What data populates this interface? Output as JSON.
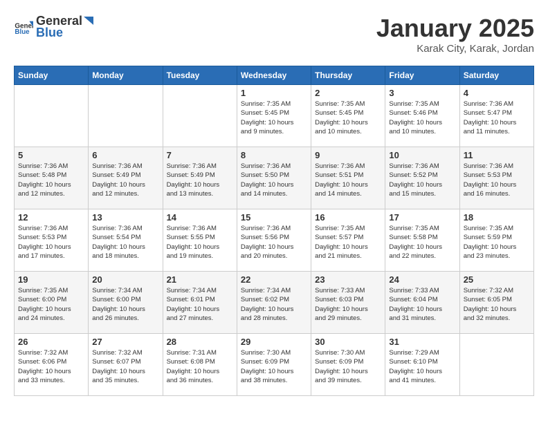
{
  "header": {
    "logo_general": "General",
    "logo_blue": "Blue",
    "month_title": "January 2025",
    "location": "Karak City, Karak, Jordan"
  },
  "days_of_week": [
    "Sunday",
    "Monday",
    "Tuesday",
    "Wednesday",
    "Thursday",
    "Friday",
    "Saturday"
  ],
  "weeks": [
    [
      {
        "day": "",
        "info": ""
      },
      {
        "day": "",
        "info": ""
      },
      {
        "day": "",
        "info": ""
      },
      {
        "day": "1",
        "info": "Sunrise: 7:35 AM\nSunset: 5:45 PM\nDaylight: 10 hours\nand 9 minutes."
      },
      {
        "day": "2",
        "info": "Sunrise: 7:35 AM\nSunset: 5:45 PM\nDaylight: 10 hours\nand 10 minutes."
      },
      {
        "day": "3",
        "info": "Sunrise: 7:35 AM\nSunset: 5:46 PM\nDaylight: 10 hours\nand 10 minutes."
      },
      {
        "day": "4",
        "info": "Sunrise: 7:36 AM\nSunset: 5:47 PM\nDaylight: 10 hours\nand 11 minutes."
      }
    ],
    [
      {
        "day": "5",
        "info": "Sunrise: 7:36 AM\nSunset: 5:48 PM\nDaylight: 10 hours\nand 12 minutes."
      },
      {
        "day": "6",
        "info": "Sunrise: 7:36 AM\nSunset: 5:49 PM\nDaylight: 10 hours\nand 12 minutes."
      },
      {
        "day": "7",
        "info": "Sunrise: 7:36 AM\nSunset: 5:49 PM\nDaylight: 10 hours\nand 13 minutes."
      },
      {
        "day": "8",
        "info": "Sunrise: 7:36 AM\nSunset: 5:50 PM\nDaylight: 10 hours\nand 14 minutes."
      },
      {
        "day": "9",
        "info": "Sunrise: 7:36 AM\nSunset: 5:51 PM\nDaylight: 10 hours\nand 14 minutes."
      },
      {
        "day": "10",
        "info": "Sunrise: 7:36 AM\nSunset: 5:52 PM\nDaylight: 10 hours\nand 15 minutes."
      },
      {
        "day": "11",
        "info": "Sunrise: 7:36 AM\nSunset: 5:53 PM\nDaylight: 10 hours\nand 16 minutes."
      }
    ],
    [
      {
        "day": "12",
        "info": "Sunrise: 7:36 AM\nSunset: 5:53 PM\nDaylight: 10 hours\nand 17 minutes."
      },
      {
        "day": "13",
        "info": "Sunrise: 7:36 AM\nSunset: 5:54 PM\nDaylight: 10 hours\nand 18 minutes."
      },
      {
        "day": "14",
        "info": "Sunrise: 7:36 AM\nSunset: 5:55 PM\nDaylight: 10 hours\nand 19 minutes."
      },
      {
        "day": "15",
        "info": "Sunrise: 7:36 AM\nSunset: 5:56 PM\nDaylight: 10 hours\nand 20 minutes."
      },
      {
        "day": "16",
        "info": "Sunrise: 7:35 AM\nSunset: 5:57 PM\nDaylight: 10 hours\nand 21 minutes."
      },
      {
        "day": "17",
        "info": "Sunrise: 7:35 AM\nSunset: 5:58 PM\nDaylight: 10 hours\nand 22 minutes."
      },
      {
        "day": "18",
        "info": "Sunrise: 7:35 AM\nSunset: 5:59 PM\nDaylight: 10 hours\nand 23 minutes."
      }
    ],
    [
      {
        "day": "19",
        "info": "Sunrise: 7:35 AM\nSunset: 6:00 PM\nDaylight: 10 hours\nand 24 minutes."
      },
      {
        "day": "20",
        "info": "Sunrise: 7:34 AM\nSunset: 6:00 PM\nDaylight: 10 hours\nand 26 minutes."
      },
      {
        "day": "21",
        "info": "Sunrise: 7:34 AM\nSunset: 6:01 PM\nDaylight: 10 hours\nand 27 minutes."
      },
      {
        "day": "22",
        "info": "Sunrise: 7:34 AM\nSunset: 6:02 PM\nDaylight: 10 hours\nand 28 minutes."
      },
      {
        "day": "23",
        "info": "Sunrise: 7:33 AM\nSunset: 6:03 PM\nDaylight: 10 hours\nand 29 minutes."
      },
      {
        "day": "24",
        "info": "Sunrise: 7:33 AM\nSunset: 6:04 PM\nDaylight: 10 hours\nand 31 minutes."
      },
      {
        "day": "25",
        "info": "Sunrise: 7:32 AM\nSunset: 6:05 PM\nDaylight: 10 hours\nand 32 minutes."
      }
    ],
    [
      {
        "day": "26",
        "info": "Sunrise: 7:32 AM\nSunset: 6:06 PM\nDaylight: 10 hours\nand 33 minutes."
      },
      {
        "day": "27",
        "info": "Sunrise: 7:32 AM\nSunset: 6:07 PM\nDaylight: 10 hours\nand 35 minutes."
      },
      {
        "day": "28",
        "info": "Sunrise: 7:31 AM\nSunset: 6:08 PM\nDaylight: 10 hours\nand 36 minutes."
      },
      {
        "day": "29",
        "info": "Sunrise: 7:30 AM\nSunset: 6:09 PM\nDaylight: 10 hours\nand 38 minutes."
      },
      {
        "day": "30",
        "info": "Sunrise: 7:30 AM\nSunset: 6:09 PM\nDaylight: 10 hours\nand 39 minutes."
      },
      {
        "day": "31",
        "info": "Sunrise: 7:29 AM\nSunset: 6:10 PM\nDaylight: 10 hours\nand 41 minutes."
      },
      {
        "day": "",
        "info": ""
      }
    ]
  ]
}
